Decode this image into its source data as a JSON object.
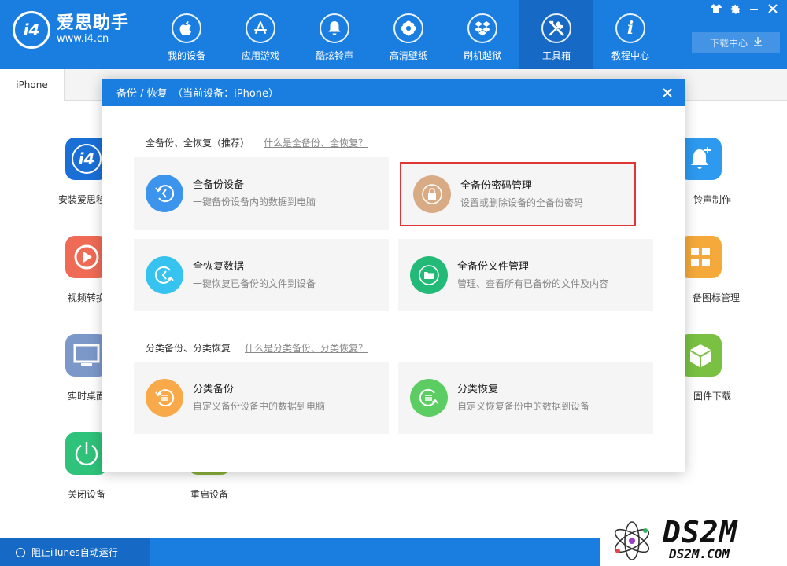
{
  "app": {
    "logo_name": "爱思助手",
    "logo_url": "www.i4.cn",
    "logo_mark": "i4"
  },
  "nav": [
    {
      "label": "我的设备",
      "icon": "apple-icon",
      "glyph": ""
    },
    {
      "label": "应用游戏",
      "icon": "app-store-icon",
      "glyph": "A"
    },
    {
      "label": "酷炫铃声",
      "icon": "bell-icon",
      "glyph": "🔔"
    },
    {
      "label": "高清壁纸",
      "icon": "flower-icon",
      "glyph": "✿"
    },
    {
      "label": "刷机越狱",
      "icon": "dropbox-icon",
      "glyph": "◈"
    },
    {
      "label": "工具箱",
      "icon": "tools-icon",
      "glyph": "✂"
    },
    {
      "label": "教程中心",
      "icon": "info-icon",
      "glyph": "i"
    }
  ],
  "active_nav": 5,
  "window_controls": [
    {
      "name": "skin-icon",
      "glyph": "👕"
    },
    {
      "name": "gear-icon",
      "glyph": "⚙"
    },
    {
      "name": "minimize-icon",
      "glyph": "—"
    },
    {
      "name": "close-window-icon",
      "glyph": "✕"
    }
  ],
  "download": {
    "label": "下载中心",
    "glyph": "⬇"
  },
  "device_tab": "iPhone",
  "tools": [
    {
      "label": "安装爱思移动",
      "color": "#1a6fd6",
      "glyph": "i4"
    },
    {
      "label": "视频转换",
      "color": "#ef6b55",
      "glyph": "▶"
    },
    {
      "label": "实时桌面",
      "color": "#7b98c9",
      "glyph": "▭"
    },
    {
      "label": "关闭设备",
      "color": "#2fc27a",
      "glyph": "⏻"
    },
    {
      "label": "重启设备",
      "color": "#8bb13b",
      "glyph": "⟳"
    },
    {
      "label": "铃声制作",
      "color": "#2d9af0",
      "glyph": "🔔"
    },
    {
      "label": "备图标管理",
      "color": "#f5a93a",
      "glyph": "▦"
    },
    {
      "label": "固件下载",
      "color": "#7ac143",
      "glyph": "⬢"
    }
  ],
  "status": {
    "label": "阻止iTunes自动运行"
  },
  "watermark": {
    "big": "DS2M",
    "small": "DS2M.COM"
  },
  "modal": {
    "title": "备份 / 恢复　（当前设备：iPhone）",
    "close_glyph": "✕",
    "section1": {
      "title": "全备份、全恢复（推荐）",
      "link": "什么是全备份、全恢复？"
    },
    "section2": {
      "title": "分类备份、分类恢复",
      "link": "什么是分类备份、分类恢复？"
    },
    "cards": [
      {
        "title": "全备份设备",
        "desc": "一键备份设备内的数据到电脑",
        "color": "#3d94ec",
        "glyph": "↺"
      },
      {
        "title": "全备份密码管理",
        "desc": "设置或删除设备的全备份密码",
        "color": "#d9ab85",
        "glyph": "🔒"
      },
      {
        "title": "全恢复数据",
        "desc": "一键恢复已备份的文件到设备",
        "color": "#36c3ef",
        "glyph": "↻"
      },
      {
        "title": "全备份文件管理",
        "desc": "管理、查看所有已备份的文件及内容",
        "color": "#22ba76",
        "glyph": "▰"
      },
      {
        "title": "分类备份",
        "desc": "自定义备份设备中的数据到电脑",
        "color": "#f8a94a",
        "glyph": "☰"
      },
      {
        "title": "分类恢复",
        "desc": "自定义恢复备份中的数据到设备",
        "color": "#5ccd62",
        "glyph": "☰"
      }
    ]
  }
}
